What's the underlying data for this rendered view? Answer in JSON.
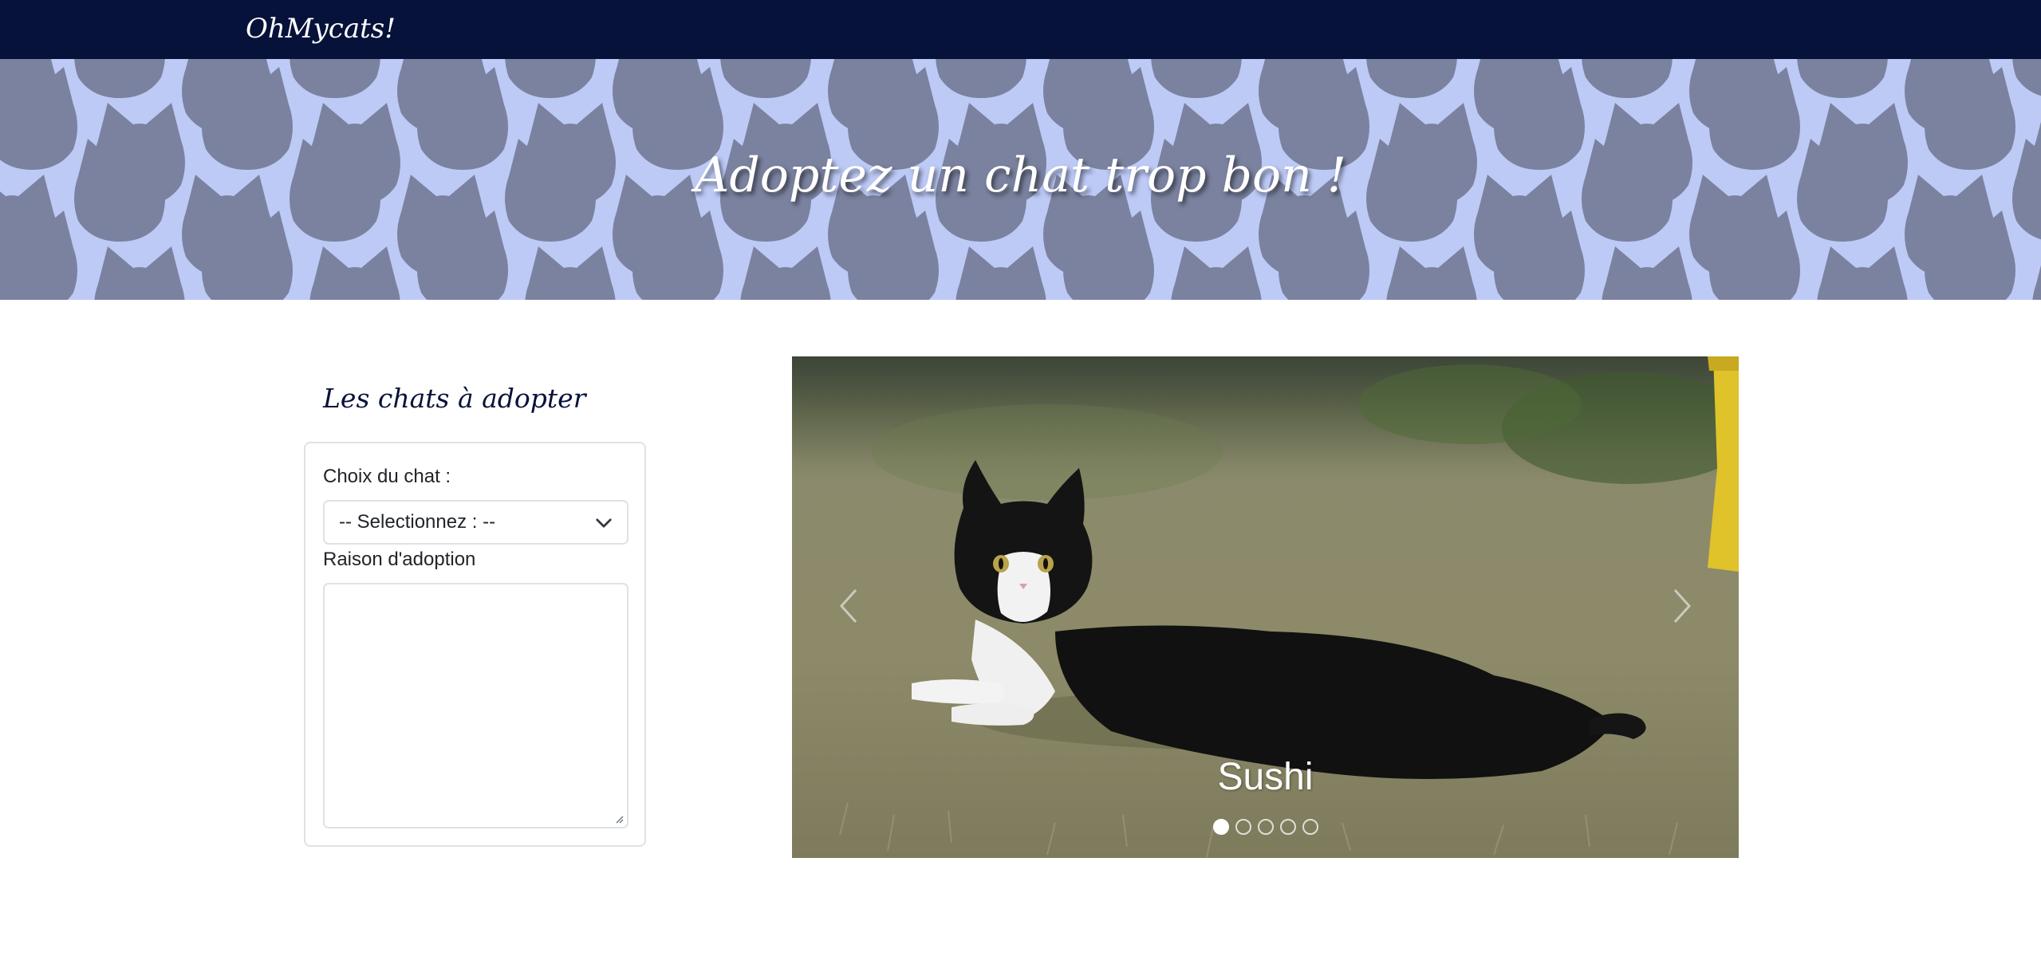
{
  "navbar": {
    "brand": "OhMycats!"
  },
  "hero": {
    "title": "Adoptez un chat trop bon !"
  },
  "form": {
    "section_title": "Les chats à adopter",
    "cat_label": "Choix du chat :",
    "cat_select_value": "-- Selectionnez : --",
    "reason_label": "Raison d'adoption",
    "reason_value": ""
  },
  "carousel": {
    "caption": "Sushi",
    "slide_count": 5,
    "active_index": 0,
    "prev_icon": "chevron-left-icon",
    "next_icon": "chevron-right-icon"
  },
  "colors": {
    "navbar_bg": "#07123a",
    "hero_bg": "#bdcaf6",
    "pattern": "#7a829f",
    "title_color": "#07123a"
  }
}
